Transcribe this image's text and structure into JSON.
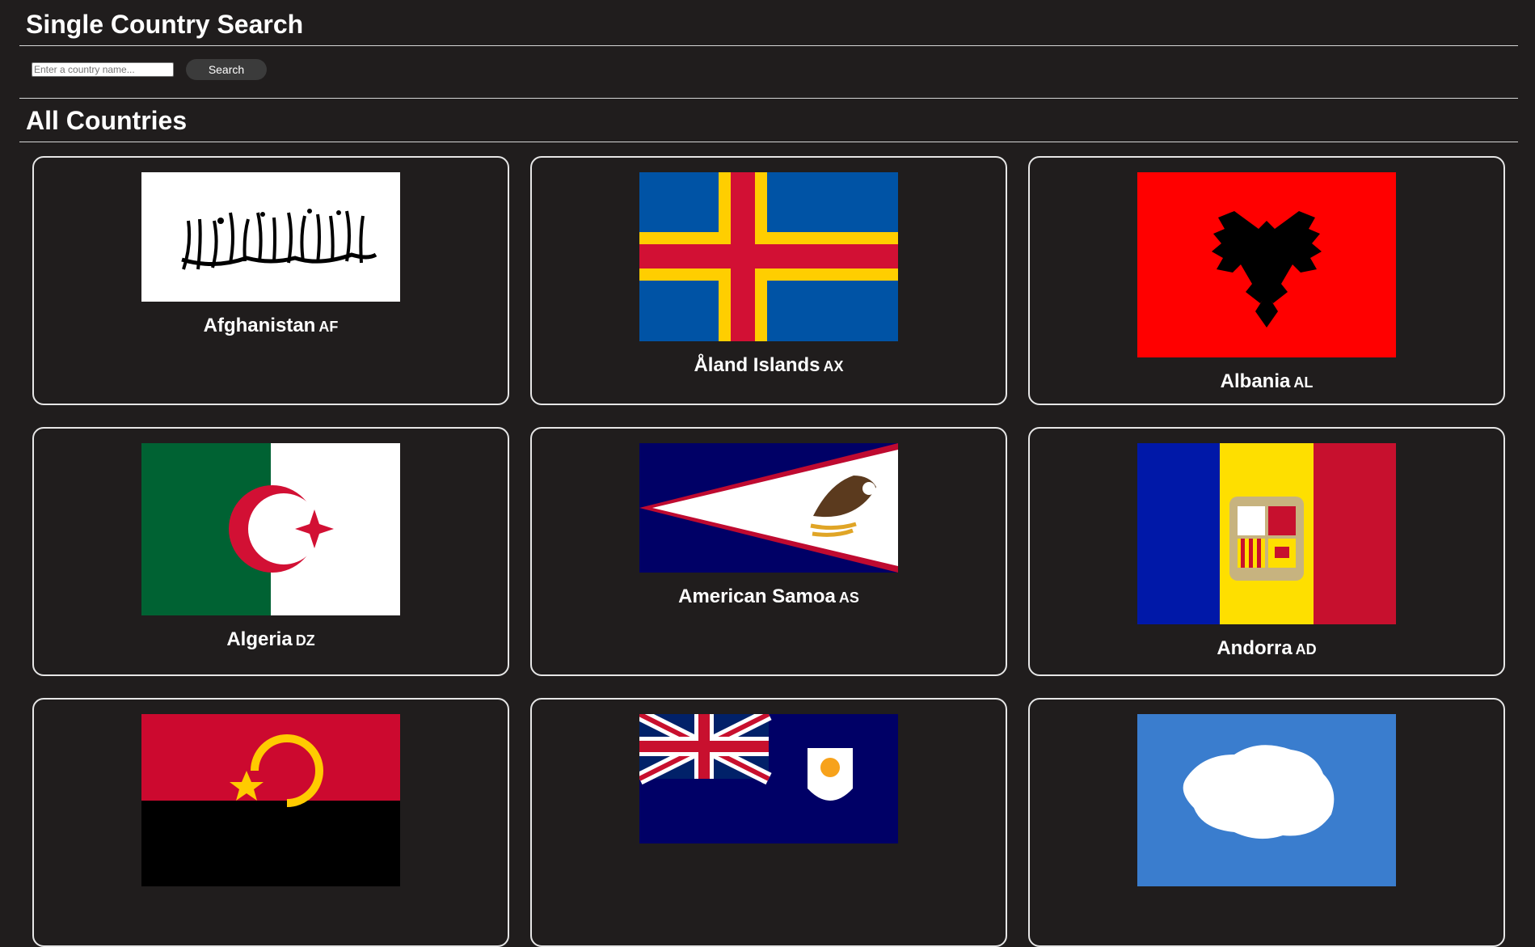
{
  "search_section": {
    "title": "Single Country Search",
    "input_placeholder": "Enter a country name...",
    "input_value": "",
    "button_label": "Search"
  },
  "all_section": {
    "title": "All Countries"
  },
  "countries": [
    {
      "name": "Afghanistan",
      "code": "AF",
      "flag": "af-flag-icon"
    },
    {
      "name": "Åland Islands",
      "code": "AX",
      "flag": "ax-flag-icon"
    },
    {
      "name": "Albania",
      "code": "AL",
      "flag": "al-flag-icon"
    },
    {
      "name": "Algeria",
      "code": "DZ",
      "flag": "dz-flag-icon"
    },
    {
      "name": "American Samoa",
      "code": "AS",
      "flag": "as-flag-icon"
    },
    {
      "name": "Andorra",
      "code": "AD",
      "flag": "ad-flag-icon"
    },
    {
      "name": "",
      "code": "",
      "flag": "ao-flag-icon"
    },
    {
      "name": "",
      "code": "",
      "flag": "ai-flag-icon"
    },
    {
      "name": "",
      "code": "",
      "flag": "aq-flag-icon"
    }
  ],
  "colors": {
    "background": "#201d1d",
    "text": "#ffffff",
    "card_border": "#e6e6e6",
    "button_bg": "#3b3b3b"
  }
}
